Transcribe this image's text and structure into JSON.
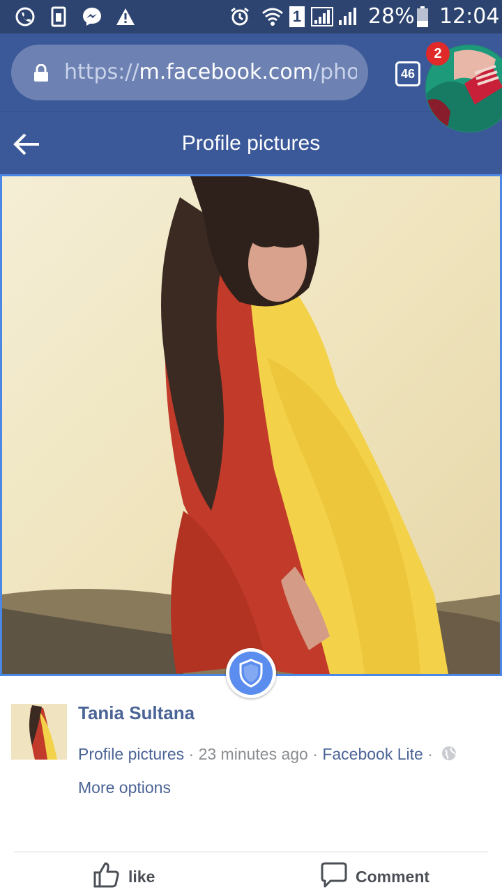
{
  "status_bar": {
    "icons": [
      "whatsapp-icon",
      "sim-card-icon",
      "messenger-icon",
      "warning-icon",
      "alarm-icon",
      "wifi-icon",
      "sim-1-icon",
      "signal-icon",
      "signal-icon"
    ],
    "sim_slot": "1",
    "battery": "28%",
    "time": "12:04"
  },
  "browser": {
    "url_scheme": "https://",
    "url_host": "m.facebook.com",
    "url_path": "/photo",
    "tab_count": "46",
    "notification_count": "2"
  },
  "header": {
    "title": "Profile pictures"
  },
  "post": {
    "author": "Tania Sultana",
    "album": "Profile pictures",
    "time_ago": "23 minutes ago",
    "app": "Facebook Lite",
    "separator": "·",
    "more_options": "More options"
  },
  "actions": {
    "like": "like",
    "comment": "Comment"
  },
  "colors": {
    "facebook_blue": "#3b5998",
    "status_bar": "#2d4470",
    "link_blue": "#4b6496",
    "shield_blue": "#5b8def",
    "badge_red": "#e02a2a"
  }
}
